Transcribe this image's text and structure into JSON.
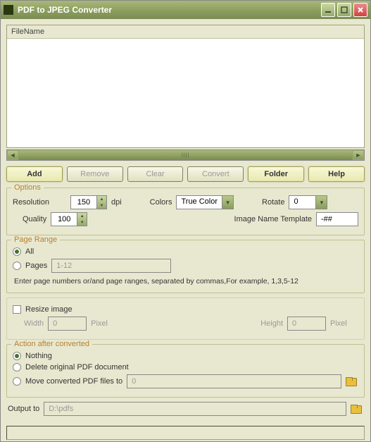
{
  "window": {
    "title": "PDF to JPEG Converter"
  },
  "file_header": "FileName",
  "buttons": {
    "add": "Add",
    "remove": "Remove",
    "clear": "Clear",
    "convert": "Convert",
    "folder": "Folder",
    "help": "Help"
  },
  "options": {
    "title": "Options",
    "resolution_label": "Resolution",
    "resolution_value": "150",
    "resolution_unit": "dpi",
    "colors_label": "Colors",
    "colors_value": "True Color",
    "rotate_label": "Rotate",
    "rotate_value": "0",
    "quality_label": "Quality",
    "quality_value": "100",
    "template_label": "Image Name Template",
    "template_value": "-##"
  },
  "pagerange": {
    "title": "Page Range",
    "all": "All",
    "pages": "Pages",
    "pages_value": "1-12",
    "hint": "Enter page numbers or/and page ranges, separated by commas,For example, 1,3,5-12"
  },
  "resize": {
    "label": "Resize image",
    "width_label": "Width",
    "width_value": "0",
    "unit": "Pixel",
    "height_label": "Height",
    "height_value": "0"
  },
  "action": {
    "title": "Action after converted",
    "nothing": "Nothing",
    "delete": "Delete original PDF document",
    "move": "Move converted PDF files to",
    "move_path": "0"
  },
  "output": {
    "label": "Output to",
    "path": "D:\\pdfs"
  }
}
